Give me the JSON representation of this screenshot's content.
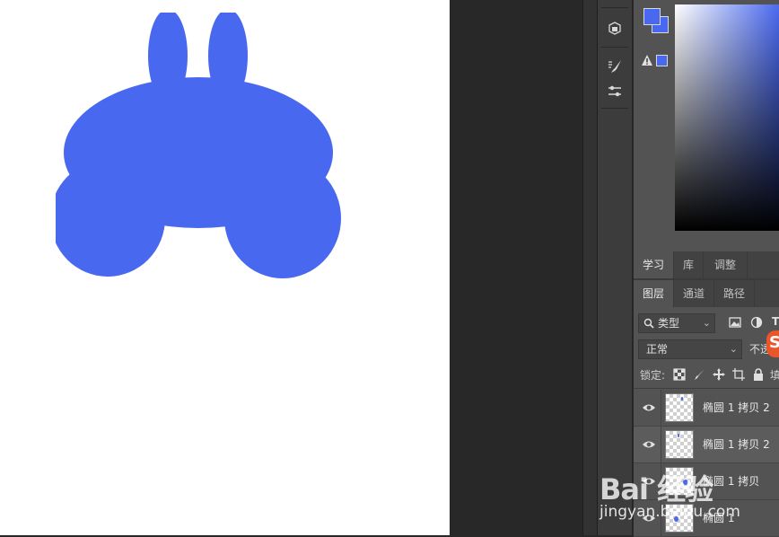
{
  "colors": {
    "shape_fill": "#4868f0",
    "foreground": "#4868f0",
    "background": "#4868f0",
    "canvas": "#ffffff",
    "pasteboard": "#282828"
  },
  "toolstrip": {
    "icons": [
      "3d-materials-icon",
      "brush-settings-icon",
      "properties-icon"
    ]
  },
  "top_tabs": [
    {
      "label": "学习",
      "active": true
    },
    {
      "label": "库",
      "active": false
    },
    {
      "label": "调整",
      "active": false
    }
  ],
  "layers_tabs": [
    {
      "label": "图层",
      "active": true
    },
    {
      "label": "通道",
      "active": false
    },
    {
      "label": "路径",
      "active": false
    }
  ],
  "filter": {
    "label": "类型"
  },
  "blend_mode": {
    "value": "正常"
  },
  "opacity": {
    "label": "不透"
  },
  "lock": {
    "label": "锁定:",
    "fill_label": "填"
  },
  "layers": [
    {
      "name": "椭圆 1 拷贝 2",
      "selected": false
    },
    {
      "name": "椭圆 1 拷贝 2",
      "selected": true
    },
    {
      "name": "椭圆 1 拷贝",
      "selected": false
    },
    {
      "name": "椭圆 1",
      "selected": false
    }
  ],
  "watermark": {
    "main": "Bai 经验",
    "sub": "jingyan.baidu.com"
  }
}
